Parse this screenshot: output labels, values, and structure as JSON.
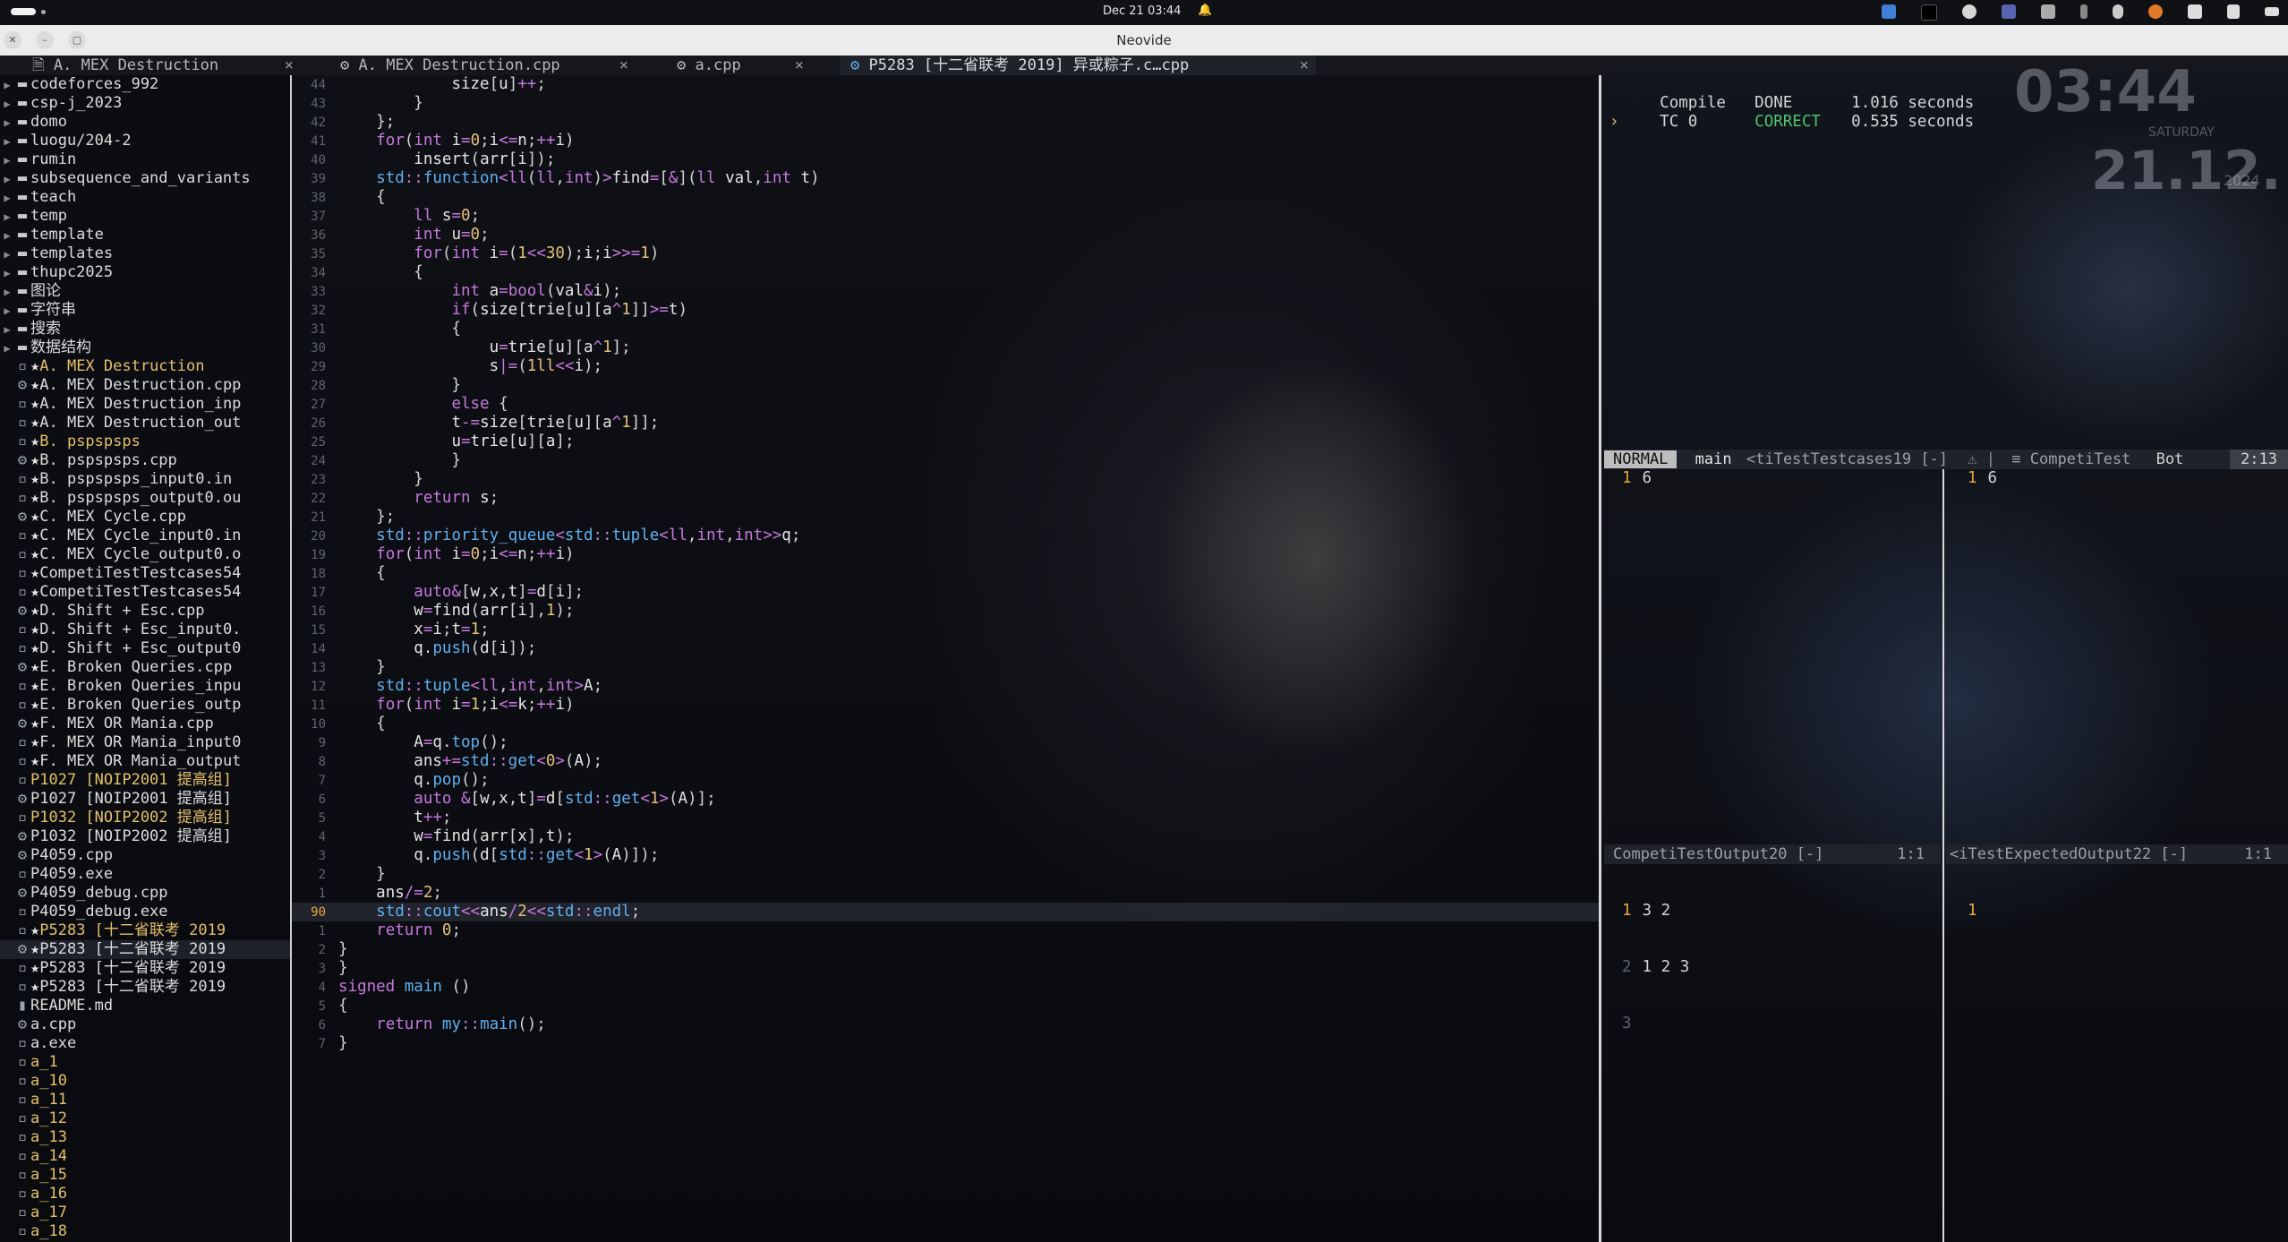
{
  "os_bar": {
    "datetime": "Dec 21  03:44",
    "bell": "🔔"
  },
  "window": {
    "title": "Neovide"
  },
  "tabs": [
    {
      "icon": "🗎",
      "label": "A. MEX Destruction",
      "close": "×"
    },
    {
      "icon": "⚙",
      "label": "A. MEX Destruction.cpp",
      "close": "×"
    },
    {
      "icon": "⚙",
      "label": "a.cpp",
      "close": "×"
    },
    {
      "icon": "⚙",
      "label": "P5283 [十二省联考 2019] 异或粽子.c…cpp",
      "close": "×"
    }
  ],
  "tree": [
    {
      "label": "codeforces_992",
      "kind": "dir"
    },
    {
      "label": "csp-j_2023",
      "kind": "dir"
    },
    {
      "label": "domo",
      "kind": "dir"
    },
    {
      "label": "luogu/204-2",
      "kind": "dir"
    },
    {
      "label": "rumin",
      "kind": "dir"
    },
    {
      "label": "subsequence_and_variants",
      "kind": "dir"
    },
    {
      "label": "teach",
      "kind": "dir"
    },
    {
      "label": "temp",
      "kind": "dir"
    },
    {
      "label": "template",
      "kind": "dir"
    },
    {
      "label": "templates",
      "kind": "dir"
    },
    {
      "label": "thupc2025",
      "kind": "dir"
    },
    {
      "label": "图论",
      "kind": "dir"
    },
    {
      "label": "字符串",
      "kind": "dir"
    },
    {
      "label": "搜索",
      "kind": "dir"
    },
    {
      "label": "数据结构",
      "kind": "dir"
    },
    {
      "label": "A. MEX Destruction",
      "kind": "file",
      "star": true,
      "mod": true
    },
    {
      "label": "A. MEX Destruction.cpp",
      "kind": "cpp",
      "star": true
    },
    {
      "label": "A. MEX Destruction_inp",
      "kind": "file",
      "star": true
    },
    {
      "label": "A. MEX Destruction_out",
      "kind": "file",
      "star": true
    },
    {
      "label": "B. pspspsps",
      "kind": "file",
      "star": true,
      "mod": true
    },
    {
      "label": "B. pspspsps.cpp",
      "kind": "cpp",
      "star": true
    },
    {
      "label": "B. pspspsps_input0.in",
      "kind": "file",
      "star": true
    },
    {
      "label": "B. pspspsps_output0.ou",
      "kind": "file",
      "star": true
    },
    {
      "label": "C. MEX Cycle.cpp",
      "kind": "cpp",
      "star": true
    },
    {
      "label": "C. MEX Cycle_input0.in",
      "kind": "file",
      "star": true
    },
    {
      "label": "C. MEX Cycle_output0.o",
      "kind": "file",
      "star": true
    },
    {
      "label": "CompetiTestTestcases54",
      "kind": "file",
      "star": true
    },
    {
      "label": "CompetiTestTestcases54",
      "kind": "file",
      "star": true
    },
    {
      "label": "D. Shift + Esc.cpp",
      "kind": "cpp",
      "star": true
    },
    {
      "label": "D. Shift + Esc_input0.",
      "kind": "file",
      "star": true
    },
    {
      "label": "D. Shift + Esc_output0",
      "kind": "file",
      "star": true
    },
    {
      "label": "E. Broken Queries.cpp",
      "kind": "cpp",
      "star": true
    },
    {
      "label": "E. Broken Queries_inpu",
      "kind": "file",
      "star": true
    },
    {
      "label": "E. Broken Queries_outp",
      "kind": "file",
      "star": true
    },
    {
      "label": "F. MEX OR Mania.cpp",
      "kind": "cpp",
      "star": true
    },
    {
      "label": "F. MEX OR Mania_input0",
      "kind": "file",
      "star": true
    },
    {
      "label": "F. MEX OR Mania_output",
      "kind": "file",
      "star": true
    },
    {
      "label": "P1027 [NOIP2001 提高组]",
      "kind": "file",
      "mod": true
    },
    {
      "label": "P1027 [NOIP2001 提高组]",
      "kind": "cpp"
    },
    {
      "label": "P1032 [NOIP2002 提高组]",
      "kind": "file",
      "mod": true
    },
    {
      "label": "P1032 [NOIP2002 提高组]",
      "kind": "cpp"
    },
    {
      "label": "P4059.cpp",
      "kind": "cpp"
    },
    {
      "label": "P4059.exe",
      "kind": "file"
    },
    {
      "label": "P4059_debug.cpp",
      "kind": "cpp"
    },
    {
      "label": "P4059_debug.exe",
      "kind": "file"
    },
    {
      "label": "P5283 [十二省联考 2019",
      "kind": "file",
      "star": true,
      "mod": true
    },
    {
      "label": "P5283 [十二省联考 2019",
      "kind": "cpp",
      "star": true,
      "sel": true
    },
    {
      "label": "P5283 [十二省联考 2019",
      "kind": "file",
      "star": true
    },
    {
      "label": "P5283 [十二省联考 2019",
      "kind": "file",
      "star": true
    },
    {
      "label": "README.md",
      "kind": "md"
    },
    {
      "label": "a.cpp",
      "kind": "cpp"
    },
    {
      "label": "a.exe",
      "kind": "file"
    },
    {
      "label": "a_1",
      "kind": "file",
      "mod": true
    },
    {
      "label": "a_10",
      "kind": "file",
      "mod": true
    },
    {
      "label": "a_11",
      "kind": "file",
      "mod": true
    },
    {
      "label": "a_12",
      "kind": "file",
      "mod": true
    },
    {
      "label": "a_13",
      "kind": "file",
      "mod": true
    },
    {
      "label": "a_14",
      "kind": "file",
      "mod": true
    },
    {
      "label": "a_15",
      "kind": "file",
      "mod": true
    },
    {
      "label": "a_16",
      "kind": "file",
      "mod": true
    },
    {
      "label": "a_17",
      "kind": "file",
      "mod": true
    },
    {
      "label": "a_18",
      "kind": "file",
      "mod": true
    }
  ],
  "code": [
    {
      "n": "44",
      "t": "            size[u]++;"
    },
    {
      "n": "43",
      "t": "        }"
    },
    {
      "n": "42",
      "t": "    };"
    },
    {
      "n": "41",
      "t": "    for(int i=0;i<=n;++i)"
    },
    {
      "n": "40",
      "t": "        insert(arr[i]);"
    },
    {
      "n": "39",
      "t": "    std::function<ll(ll,int)>find=[&](ll val,int t)"
    },
    {
      "n": "38",
      "t": "    {"
    },
    {
      "n": "37",
      "t": "        ll s=0;"
    },
    {
      "n": "36",
      "t": "        int u=0;"
    },
    {
      "n": "35",
      "t": "        for(int i=(1<<30);i;i>>=1)"
    },
    {
      "n": "34",
      "t": "        {"
    },
    {
      "n": "33",
      "t": "            int a=bool(val&i);"
    },
    {
      "n": "32",
      "t": "            if(size[trie[u][a^1]]>=t)"
    },
    {
      "n": "31",
      "t": "            {"
    },
    {
      "n": "30",
      "t": "                u=trie[u][a^1];"
    },
    {
      "n": "29",
      "t": "                s|=(1ll<<i);"
    },
    {
      "n": "28",
      "t": "            }"
    },
    {
      "n": "27",
      "t": "            else {"
    },
    {
      "n": "26",
      "t": "            t-=size[trie[u][a^1]];"
    },
    {
      "n": "25",
      "t": "            u=trie[u][a];"
    },
    {
      "n": "24",
      "t": "            }"
    },
    {
      "n": "23",
      "t": "        }"
    },
    {
      "n": "22",
      "t": "        return s;"
    },
    {
      "n": "21",
      "t": "    };"
    },
    {
      "n": "20",
      "t": "    std::priority_queue<std::tuple<ll,int,int>>q;"
    },
    {
      "n": "19",
      "t": "    for(int i=0;i<=n;++i)"
    },
    {
      "n": "18",
      "t": "    {"
    },
    {
      "n": "17",
      "t": "        auto&[w,x,t]=d[i];"
    },
    {
      "n": "16",
      "t": "        w=find(arr[i],1);"
    },
    {
      "n": "15",
      "t": "        x=i;t=1;"
    },
    {
      "n": "14",
      "t": "        q.push(d[i]);"
    },
    {
      "n": "13",
      "t": "    }"
    },
    {
      "n": "12",
      "t": "    std::tuple<ll,int,int>A;"
    },
    {
      "n": "11",
      "t": "    for(int i=1;i<=k;++i)"
    },
    {
      "n": "10",
      "t": "    {"
    },
    {
      "n": "9",
      "t": "        A=q.top();"
    },
    {
      "n": "8",
      "t": "        ans+=std::get<0>(A);"
    },
    {
      "n": "7",
      "t": "        q.pop();"
    },
    {
      "n": "6",
      "t": "        auto &[w,x,t]=d[std::get<1>(A)];"
    },
    {
      "n": "5",
      "t": "        t++;"
    },
    {
      "n": "4",
      "t": "        w=find(arr[x],t);"
    },
    {
      "n": "3",
      "t": "        q.push(d[std::get<1>(A)]);"
    },
    {
      "n": "2",
      "t": "    }"
    },
    {
      "n": "1",
      "t": "    ans/=2;"
    },
    {
      "n": "90",
      "t": "    std::cout<<ans/2<<std::endl;",
      "cur": true
    },
    {
      "n": "1",
      "t": "    return 0;"
    },
    {
      "n": "2",
      "t": "}"
    },
    {
      "n": "3",
      "t": "}"
    },
    {
      "n": "4",
      "t": "signed main ()"
    },
    {
      "n": "5",
      "t": "{"
    },
    {
      "n": "6",
      "t": "    return my::main();"
    },
    {
      "n": "7",
      "t": "}"
    }
  ],
  "results": [
    {
      "marker": "",
      "name": "Compile",
      "status": "DONE",
      "time": "1.016 seconds"
    },
    {
      "marker": "›",
      "name": "TC 0",
      "status": "CORRECT",
      "time": "0.535 seconds"
    }
  ],
  "status": {
    "mode": "NORMAL",
    "branch_icon": "",
    "branch": "main",
    "file": "<tiTestTestcases19 [-]",
    "icons": "⚠ |",
    "plugin": "≡ CompetiTest",
    "pos": "Bot",
    "cursor": "2:13"
  },
  "input_pane": {
    "ln": "1",
    "text": "6"
  },
  "input_pane_right": {
    "ln": "1",
    "text": "6"
  },
  "output_header_left": {
    "title": "CompetiTestOutput20 [-]",
    "pos": "1:1"
  },
  "output_header_right": {
    "title": "<iTestExpectedOutput22 [-]",
    "pos": "1:1"
  },
  "output_lines": [
    {
      "ln": "1",
      "text": "3 2"
    },
    {
      "ln": "2",
      "text": "1 2 3"
    },
    {
      "ln": "3",
      "text": ""
    }
  ],
  "expected_lines": [
    {
      "ln": "1",
      "text": ""
    }
  ],
  "widget": {
    "time": "03:44",
    "day": "SATURDAY",
    "date": "21.12.",
    "year": "2024"
  }
}
